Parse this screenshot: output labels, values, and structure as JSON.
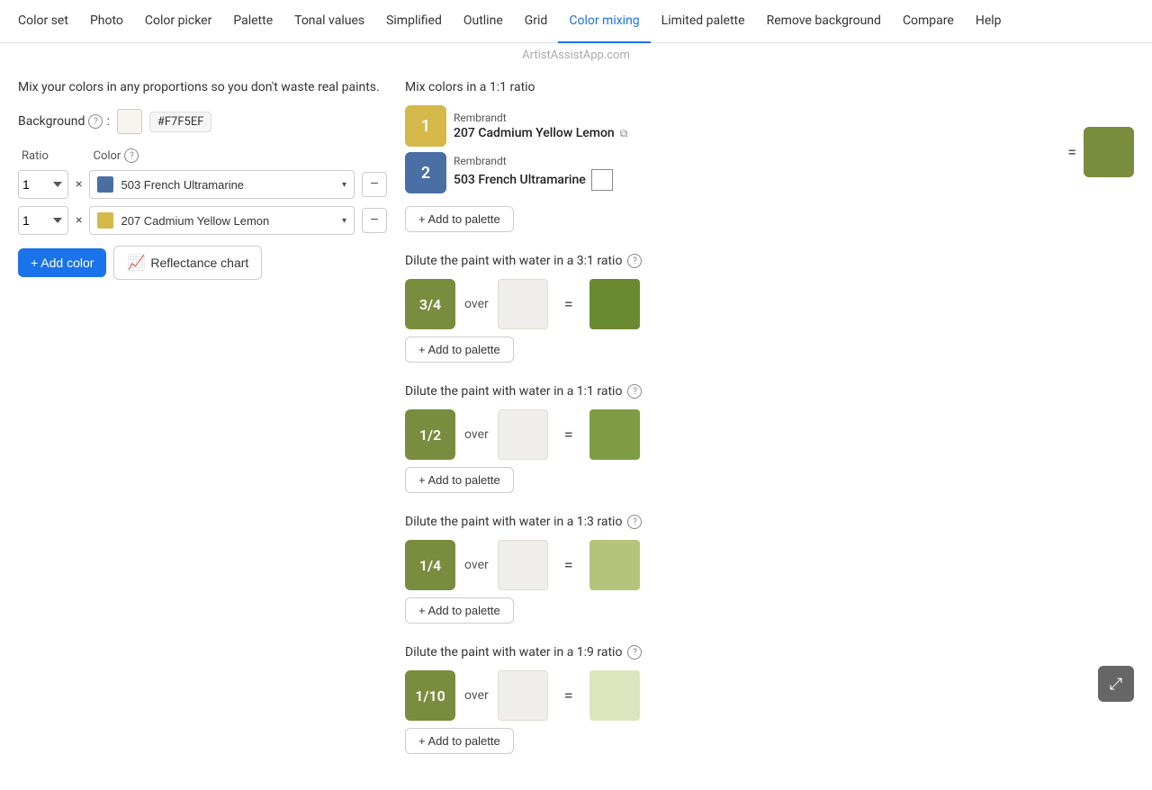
{
  "nav": {
    "items": [
      {
        "label": "Color set",
        "id": "color-set",
        "active": false
      },
      {
        "label": "Photo",
        "id": "photo",
        "active": false
      },
      {
        "label": "Color picker",
        "id": "color-picker",
        "active": false
      },
      {
        "label": "Palette",
        "id": "palette",
        "active": false
      },
      {
        "label": "Tonal values",
        "id": "tonal-values",
        "active": false
      },
      {
        "label": "Simplified",
        "id": "simplified",
        "active": false
      },
      {
        "label": "Outline",
        "id": "outline",
        "active": false
      },
      {
        "label": "Grid",
        "id": "grid",
        "active": false
      },
      {
        "label": "Color mixing",
        "id": "color-mixing",
        "active": true
      },
      {
        "label": "Limited palette",
        "id": "limited-palette",
        "active": false
      },
      {
        "label": "Remove background",
        "id": "remove-bg",
        "active": false
      },
      {
        "label": "Compare",
        "id": "compare",
        "active": false
      },
      {
        "label": "Help",
        "id": "help",
        "active": false
      }
    ]
  },
  "watermark": "ArtistAssistApp.com",
  "subtitle": "Mix your colors in any proportions so you don't waste real paints.",
  "background": {
    "label": "Background",
    "color": "#F7F5EF",
    "hex": "#F7F5EF"
  },
  "col_headers": {
    "ratio": "Ratio",
    "color": "Color"
  },
  "color_rows": [
    {
      "ratio": "1",
      "swatch": "#4a6fa5",
      "name": "503 French Ultramarine"
    },
    {
      "ratio": "1",
      "swatch": "#d4b84a",
      "name": "207 Cadmium Yellow Lemon"
    }
  ],
  "buttons": {
    "add_color": "+ Add color",
    "reflectance_chart": "Reflectance chart"
  },
  "mix_11": {
    "title": "Mix colors in a 1:1 ratio",
    "paints": [
      {
        "ratio": "1",
        "brand": "Rembrandt",
        "name": "207 Cadmium Yellow Lemon",
        "has_link": true,
        "swatch": "#d4b84a"
      },
      {
        "ratio": "1",
        "brand": "Rembrandt",
        "name": "503 French Ultramarine",
        "has_transparent": true,
        "swatch": "#4a6fa5"
      }
    ],
    "result_color": "#7a8c3e",
    "add_palette_label": "+ Add to palette"
  },
  "dilute_sections": [
    {
      "title": "Dilute the paint with water in a 3:1 ratio",
      "ratio_label": "3/4",
      "result_color": "#6a8a32",
      "add_palette_label": "+ Add to palette"
    },
    {
      "title": "Dilute the paint with water in a 1:1 ratio",
      "ratio_label": "1/2",
      "result_color": "#7d9c44",
      "add_palette_label": "+ Add to palette"
    },
    {
      "title": "Dilute the paint with water in a 1:3 ratio",
      "ratio_label": "1/4",
      "result_color": "#b5c47a",
      "add_palette_label": "+ Add to palette"
    },
    {
      "title": "Dilute the paint with water in a 1:9 ratio",
      "ratio_label": "1/10",
      "result_color": "#dde5be",
      "add_palette_label": "+ Add to palette"
    }
  ],
  "icons": {
    "help": "?",
    "add": "+",
    "chart": "📈",
    "plus": "+",
    "link_out": "⧉",
    "fullscreen": "⤢",
    "minus": "−",
    "chevron_down": "▾"
  }
}
